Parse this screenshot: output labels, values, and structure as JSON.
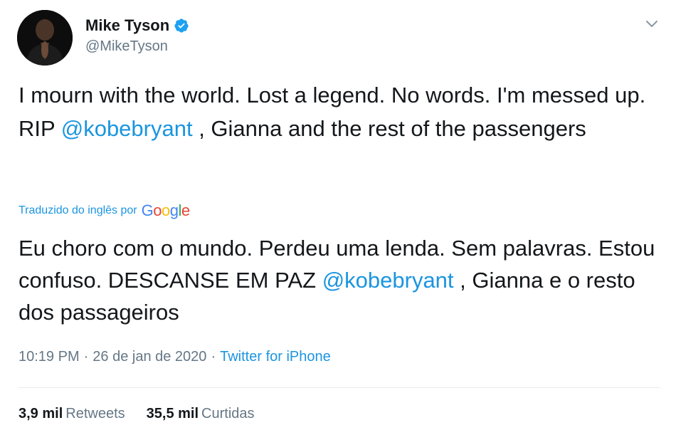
{
  "author": {
    "display_name": "Mike Tyson",
    "handle": "@MikeTyson",
    "verified": true,
    "avatar_icon": "avatar-photo",
    "verified_icon": "verified-badge-icon"
  },
  "tweet": {
    "text_part1": "I mourn with the world.  Lost a legend.  No words.  I'm messed up.  RIP ",
    "mention": "@kobebryant",
    "text_part2": " , Gianna and the rest of the passengers"
  },
  "translation": {
    "label": "Traduzido do inglês por",
    "provider": "Google",
    "text_part1": "Eu choro com o mundo. Perdeu uma lenda. Sem palavras. Estou confuso. DESCANSE EM PAZ ",
    "mention": "@kobebryant",
    "text_part2": " , Gianna e o resto dos passageiros"
  },
  "meta": {
    "time": "10:19 PM",
    "separator1": "·",
    "date": "26 de jan de 2020",
    "separator2": "·",
    "source": "Twitter for iPhone"
  },
  "stats": {
    "retweets_count": "3,9 mil",
    "retweets_label": "Retweets",
    "likes_count": "35,5 mil",
    "likes_label": "Curtidas"
  },
  "colors": {
    "link": "#1b95e0",
    "secondary_text": "#657786",
    "primary_text": "#14171a",
    "divider": "#e6ecf0"
  },
  "icons": {
    "caret": "chevron-down-icon"
  }
}
